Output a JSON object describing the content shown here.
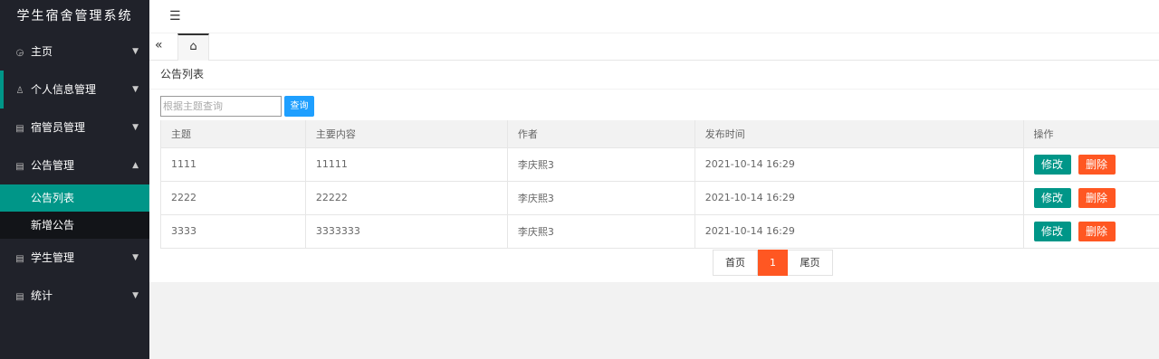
{
  "app": {
    "title": "学生宿舍管理系统"
  },
  "sidebar": {
    "items": [
      {
        "label": "主页",
        "icon": "dashboard-icon"
      },
      {
        "label": "个人信息管理",
        "icon": "user-icon"
      },
      {
        "label": "宿管员管理",
        "icon": "file-icon"
      },
      {
        "label": "公告管理",
        "icon": "file-icon"
      },
      {
        "label": "学生管理",
        "icon": "file-icon"
      },
      {
        "label": "统计",
        "icon": "file-icon"
      }
    ],
    "submenu": [
      {
        "label": "公告列表",
        "active": true
      },
      {
        "label": "新增公告",
        "active": false
      }
    ]
  },
  "page": {
    "title": "公告列表"
  },
  "search": {
    "placeholder": "根据主题查询",
    "value": "",
    "button": "查询"
  },
  "table": {
    "headers": [
      "主题",
      "主要内容",
      "作者",
      "发布时间",
      "操作"
    ],
    "rows": [
      {
        "subject": "1111",
        "content": "11111",
        "author": "李庆熙3",
        "time": "2021-10-14 16:29"
      },
      {
        "subject": "2222",
        "content": "22222",
        "author": "李庆熙3",
        "time": "2021-10-14 16:29"
      },
      {
        "subject": "3333",
        "content": "3333333",
        "author": "李庆熙3",
        "time": "2021-10-14 16:29"
      }
    ],
    "actions": {
      "edit": "修改",
      "delete": "删除"
    }
  },
  "pager": {
    "first": "首页",
    "current": "1",
    "last": "尾页"
  },
  "colors": {
    "sidebar": "#20222a",
    "accent": "#009688",
    "danger": "#ff5722",
    "primary": "#1e9fff"
  }
}
